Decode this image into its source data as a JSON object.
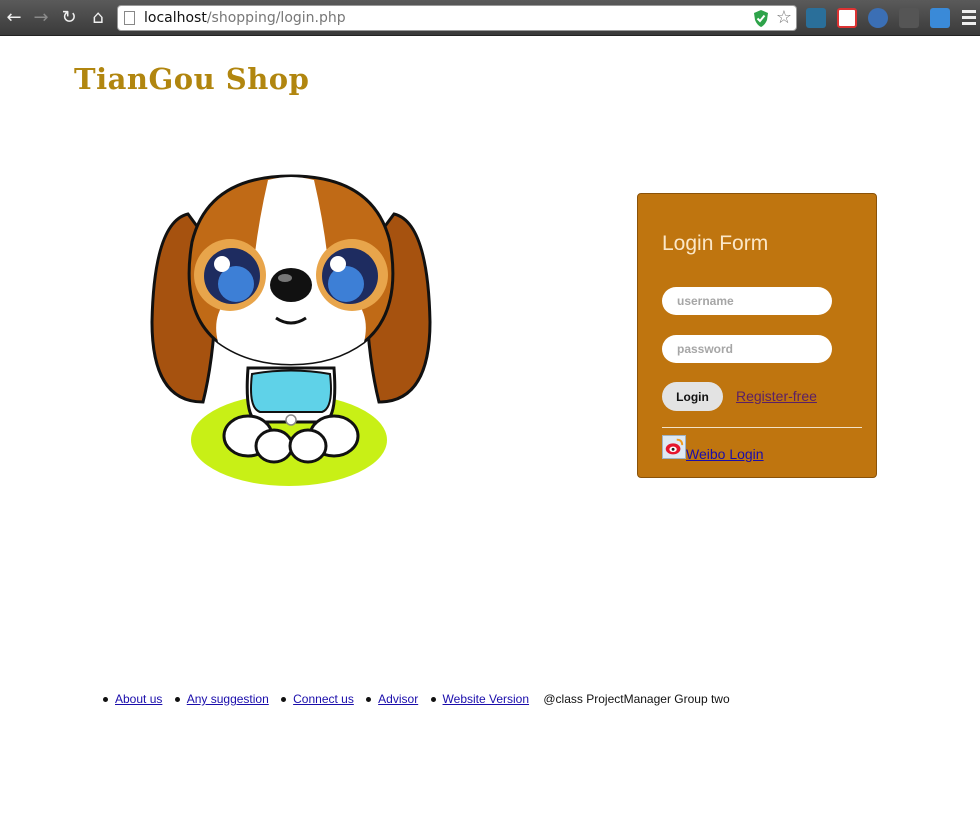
{
  "browser": {
    "url_host": "localhost",
    "url_path": "/shopping/login.php"
  },
  "site": {
    "logo_text": "TianGou Shop"
  },
  "login_form": {
    "title": "Login Form",
    "username_placeholder": "username",
    "password_placeholder": "password",
    "login_button": "Login",
    "register_link": "Register-free",
    "weibo_link": "Weibo Login"
  },
  "footer": {
    "links": [
      "About us",
      "Any suggestion",
      "Connect us",
      "Advisor",
      "Website Version"
    ],
    "credit": "@class ProjectManager Group two"
  },
  "colors": {
    "logo": "#b1860f",
    "login_box": "#bf750f",
    "link": "#1a0dab",
    "register_link": "#5a1f66"
  }
}
